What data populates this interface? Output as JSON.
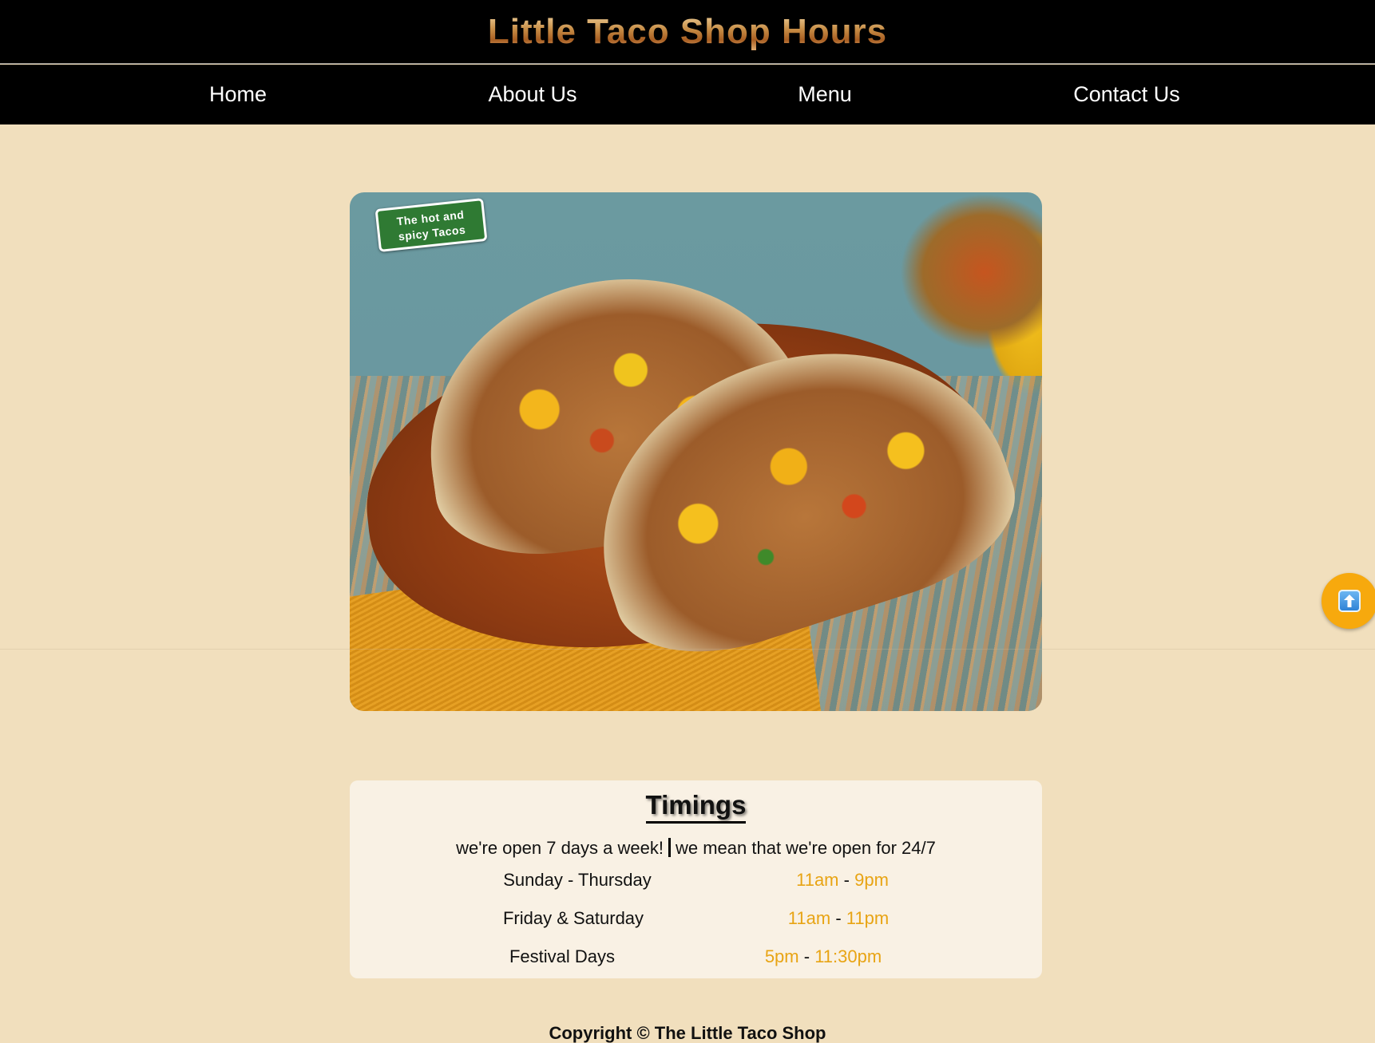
{
  "header": {
    "title": "Little Taco Shop Hours"
  },
  "nav": {
    "items": [
      {
        "label": "Home"
      },
      {
        "label": "About Us"
      },
      {
        "label": "Menu"
      },
      {
        "label": "Contact Us"
      }
    ]
  },
  "hero": {
    "image_icon": "tacos-photo",
    "tag_line1": "The hot and",
    "tag_line2": "spicy Tacos"
  },
  "timings": {
    "title": "Timings",
    "tagline_part1": "we're open 7 days a week!",
    "tagline_part2": "we mean that we're open for 24/7",
    "rows": [
      {
        "day": "Sunday - Thursday",
        "open": "11am",
        "sep": "-",
        "close": "9pm"
      },
      {
        "day": "Friday & Saturday",
        "open": "11am",
        "sep": "-",
        "close": "11pm"
      },
      {
        "day": "Festival Days",
        "open": "5pm",
        "sep": "-",
        "close": "11:30pm"
      }
    ]
  },
  "footer": {
    "copyright": "Copyright © The Little Taco Shop"
  },
  "scroll_top": {
    "icon": "arrow-up-icon"
  },
  "colors": {
    "background": "#f1dfbd",
    "header_bg": "#000000",
    "hours_accent": "#e8a414",
    "scroll_button": "#f7a90d"
  }
}
